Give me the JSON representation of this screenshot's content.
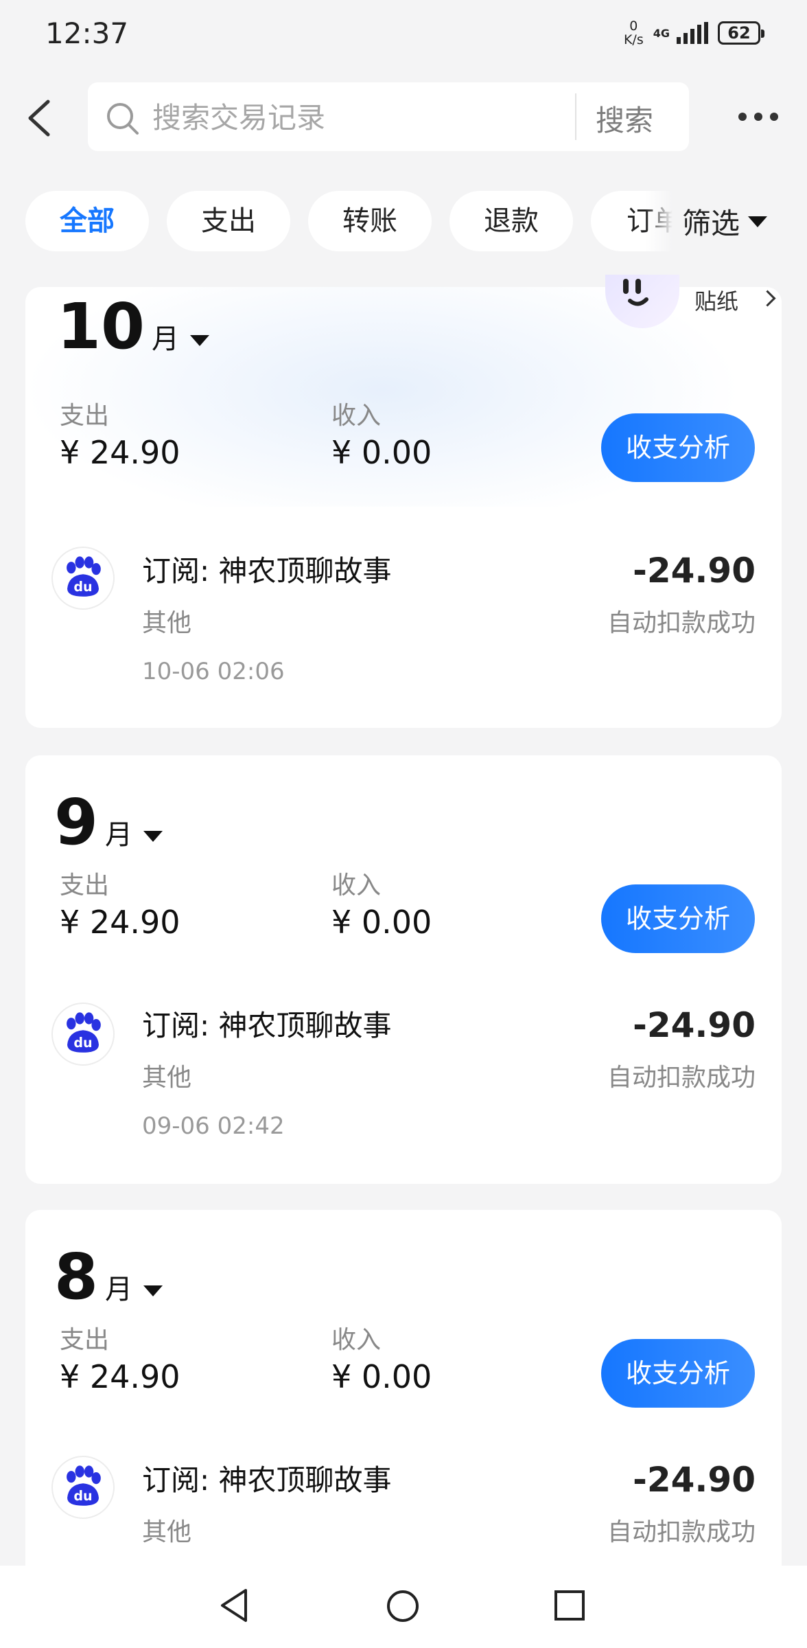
{
  "status_bar": {
    "time": "12:37",
    "net_speed_value": "0",
    "net_speed_unit": "K/s",
    "network_type": "4G",
    "battery_level": "62"
  },
  "header": {
    "search_placeholder": "搜索交易记录",
    "search_button": "搜索"
  },
  "filters": {
    "tabs": [
      {
        "label": "全部",
        "active": true
      },
      {
        "label": "支出",
        "active": false
      },
      {
        "label": "转账",
        "active": false
      },
      {
        "label": "退款",
        "active": false
      },
      {
        "label": "订单",
        "active": false
      }
    ],
    "filter_label": "筛选"
  },
  "sticker": {
    "label": "贴纸"
  },
  "months": [
    {
      "month_number": "10",
      "month_unit": "月",
      "expense_label": "支出",
      "expense_value": "¥ 24.90",
      "income_label": "收入",
      "income_value": "¥ 0.00",
      "analyze_button": "收支分析",
      "transaction": {
        "title": "订阅: 神农顶聊故事",
        "category": "其他",
        "time": "10-06 02:06",
        "amount": "-24.90",
        "status": "自动扣款成功"
      }
    },
    {
      "month_number": "9",
      "month_unit": "月",
      "expense_label": "支出",
      "expense_value": "¥ 24.90",
      "income_label": "收入",
      "income_value": "¥ 0.00",
      "analyze_button": "收支分析",
      "transaction": {
        "title": "订阅: 神农顶聊故事",
        "category": "其他",
        "time": "09-06 02:42",
        "amount": "-24.90",
        "status": "自动扣款成功"
      }
    },
    {
      "month_number": "8",
      "month_unit": "月",
      "expense_label": "支出",
      "expense_value": "¥ 24.90",
      "income_label": "收入",
      "income_value": "¥ 0.00",
      "analyze_button": "收支分析",
      "transaction": {
        "title": "订阅: 神农顶聊故事",
        "category": "其他",
        "amount": "-24.90",
        "status": "自动扣款成功"
      }
    }
  ],
  "colors": {
    "accent": "#1677ff",
    "background": "#f4f4f5",
    "logo_blue": "#2932e1"
  },
  "icons": [
    "back-icon",
    "search-icon",
    "more-icon",
    "chevron-down-icon",
    "baidu-logo-icon",
    "nav-back-icon",
    "nav-home-icon",
    "nav-recent-icon"
  ]
}
